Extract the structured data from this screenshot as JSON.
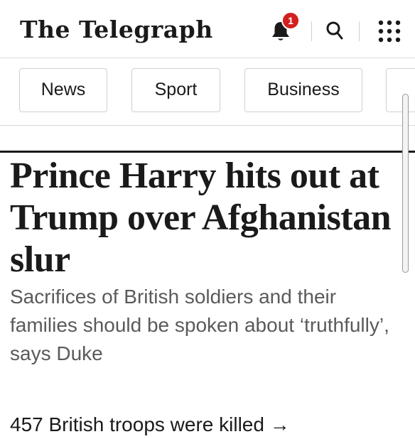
{
  "header": {
    "logo_text": "The Telegraph",
    "notification_count": "1",
    "icons": [
      "bell-icon",
      "search-icon",
      "grid-menu-icon"
    ]
  },
  "nav": {
    "tabs": [
      {
        "label": "News"
      },
      {
        "label": "Sport"
      },
      {
        "label": "Business"
      }
    ]
  },
  "article": {
    "headline": "Prince Harry hits out at Trump over Afghanistan slur",
    "standfirst": "Sacrifices of British soldiers and their families should be spoken about ‘truthfully’, says Duke",
    "related_link": "457 British troops were killed →"
  },
  "colors": {
    "badge": "#d21f1f",
    "text": "#1a1a1a",
    "standfirst_text": "#5a5a5a",
    "tab_border": "#d0d0d0"
  }
}
